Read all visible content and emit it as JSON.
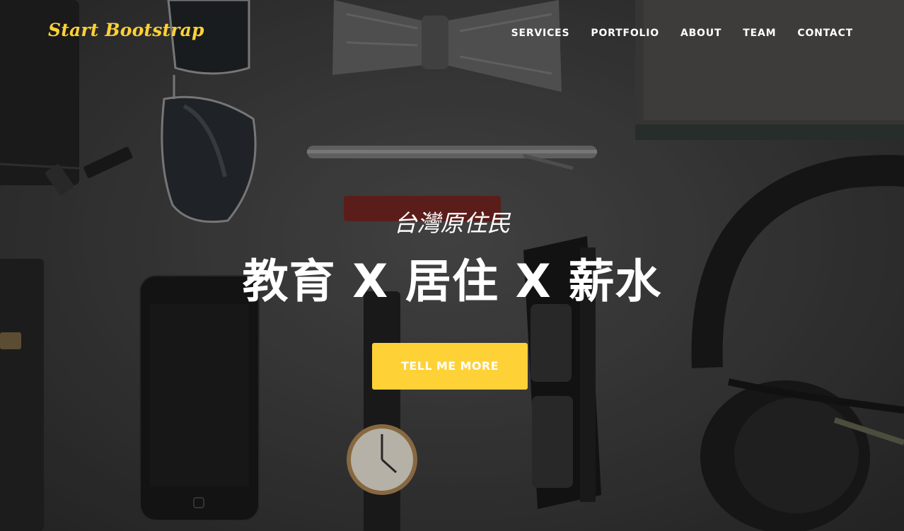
{
  "navbar": {
    "brand": "Start Bootstrap",
    "links": [
      "SERVICES",
      "PORTFOLIO",
      "ABOUT",
      "TEAM",
      "CONTACT"
    ]
  },
  "intro": {
    "lead_in": "台灣原住民",
    "heading": "教育 X 居住 X 薪水",
    "button_label": "TELL ME MORE"
  },
  "colors": {
    "accent": "#fed136",
    "text": "#ffffff",
    "background": "#3a3a3a"
  }
}
